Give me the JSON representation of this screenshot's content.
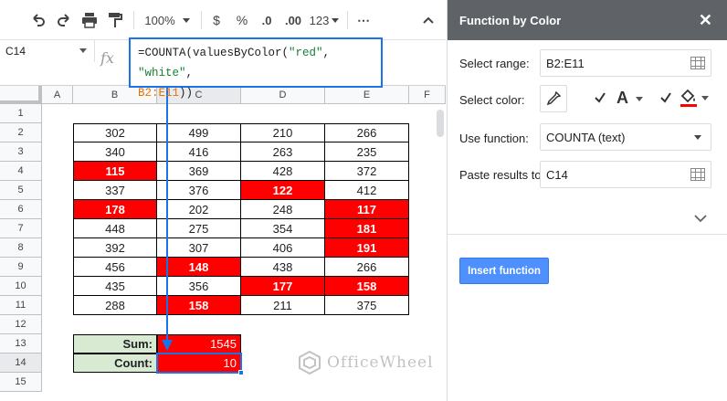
{
  "toolbar": {
    "zoom": "100%",
    "currency": "$",
    "percent": "%",
    "dec_less": ".0",
    "dec_more": ".00",
    "more_formats": "123",
    "more": "⋯"
  },
  "formula_bar": {
    "name_box": "C14",
    "fx": "fx",
    "formula_parts": {
      "p1": "=COUNTA(valuesByColor(",
      "s1": "\"red\"",
      "comma": ", ",
      "s2": "\"white\"",
      "comma2": ",",
      "range": "B2:E11",
      "end": "))"
    }
  },
  "grid": {
    "columns": [
      "A",
      "B",
      "C",
      "D",
      "E",
      "F"
    ],
    "rows": [
      "1",
      "2",
      "3",
      "4",
      "5",
      "6",
      "7",
      "8",
      "9",
      "10",
      "11",
      "12",
      "13",
      "14",
      "15"
    ],
    "table": [
      [
        {
          "v": "302",
          "red": false
        },
        {
          "v": "499",
          "red": false
        },
        {
          "v": "210",
          "red": false
        },
        {
          "v": "266",
          "red": false
        }
      ],
      [
        {
          "v": "340",
          "red": false
        },
        {
          "v": "416",
          "red": false
        },
        {
          "v": "263",
          "red": false
        },
        {
          "v": "235",
          "red": false
        }
      ],
      [
        {
          "v": "115",
          "red": true
        },
        {
          "v": "369",
          "red": false
        },
        {
          "v": "428",
          "red": false
        },
        {
          "v": "372",
          "red": false
        }
      ],
      [
        {
          "v": "337",
          "red": false
        },
        {
          "v": "376",
          "red": false
        },
        {
          "v": "122",
          "red": true
        },
        {
          "v": "412",
          "red": false
        }
      ],
      [
        {
          "v": "178",
          "red": true
        },
        {
          "v": "202",
          "red": false
        },
        {
          "v": "248",
          "red": false
        },
        {
          "v": "117",
          "red": true
        }
      ],
      [
        {
          "v": "448",
          "red": false
        },
        {
          "v": "275",
          "red": false
        },
        {
          "v": "354",
          "red": false
        },
        {
          "v": "181",
          "red": true
        }
      ],
      [
        {
          "v": "392",
          "red": false
        },
        {
          "v": "307",
          "red": false
        },
        {
          "v": "406",
          "red": false
        },
        {
          "v": "191",
          "red": true
        }
      ],
      [
        {
          "v": "456",
          "red": false
        },
        {
          "v": "148",
          "red": true
        },
        {
          "v": "438",
          "red": false
        },
        {
          "v": "266",
          "red": false
        }
      ],
      [
        {
          "v": "435",
          "red": false
        },
        {
          "v": "356",
          "red": false
        },
        {
          "v": "177",
          "red": true
        },
        {
          "v": "158",
          "red": true
        }
      ],
      [
        {
          "v": "288",
          "red": false
        },
        {
          "v": "158",
          "red": true
        },
        {
          "v": "211",
          "red": false
        },
        {
          "v": "375",
          "red": false
        }
      ]
    ],
    "summary": {
      "sum_label": "Sum:",
      "sum_value": "1545",
      "count_label": "Count:",
      "count_value": "10"
    },
    "colors": {
      "highlight": "#ff0000",
      "label_bg": "#d9ead3",
      "selection": "#1a73e8"
    }
  },
  "panel": {
    "title": "Function by Color",
    "close": "✕",
    "select_range_label": "Select range:",
    "select_range_value": "B2:E11",
    "select_color_label": "Select color:",
    "text_glyph": "A",
    "use_function_label": "Use function:",
    "use_function_value": "COUNTA (text)",
    "paste_label": "Paste results to:",
    "paste_value": "C14",
    "insert_button": "Insert function",
    "fill_color": "#ff0000"
  },
  "watermark": {
    "text": "OfficeWheel"
  }
}
